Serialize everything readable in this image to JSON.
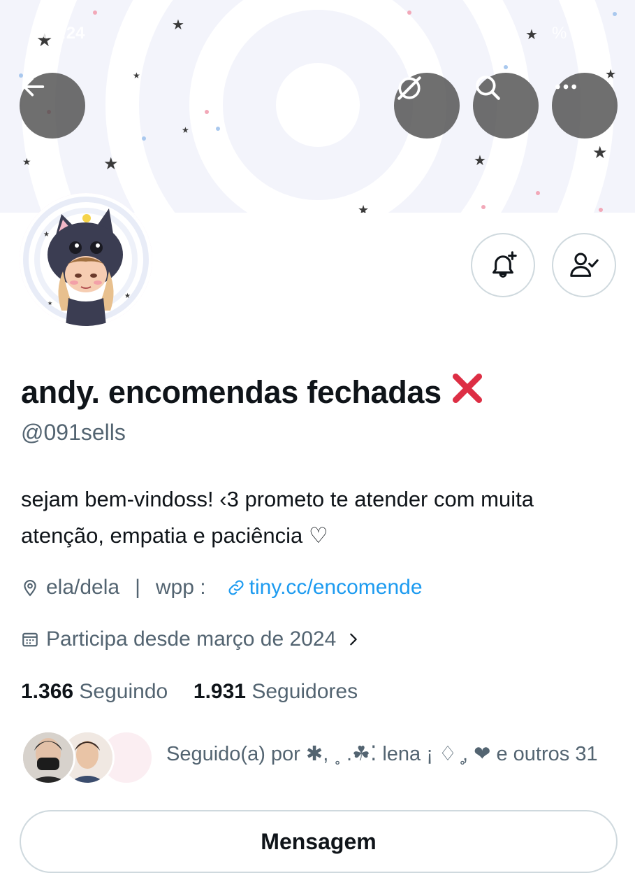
{
  "status_bar": {
    "time": "09:24",
    "battery": "%"
  },
  "profile": {
    "display_name": "andy. encomendas fechadas",
    "handle": "@091sells",
    "bio_line1": "sejam bem-vindoss! ‹3 prometo te atender com muita",
    "bio_line2": "atenção, empatia e paciência ♡",
    "location": "ela/dela",
    "separator": "|",
    "wpp_label": "wpp :",
    "link_text": "tiny.cc/encomende",
    "joined": "Participa desde março de 2024",
    "following_count": "1.366",
    "following_label": "Seguindo",
    "followers_count": "1.931",
    "followers_label": "Seguidores",
    "followed_by": "Seguido(a) por ✱, ˳ .☘︎⁚ lena ¡ ♢ ̥, ❤ e outros 31",
    "message_button": "Mensagem"
  },
  "icons": {
    "back": "back-arrow-icon",
    "grok": "grok-icon",
    "search": "search-icon",
    "more": "more-icon",
    "notify": "bell-plus-icon",
    "following": "user-check-icon",
    "location": "location-pin-icon",
    "link": "link-icon",
    "calendar": "calendar-icon"
  },
  "colors": {
    "link": "#1d9bf0",
    "secondary_text": "#536471",
    "primary_text": "#0f1419",
    "border": "#cfd9de",
    "x_mark": "#dd2e44"
  }
}
